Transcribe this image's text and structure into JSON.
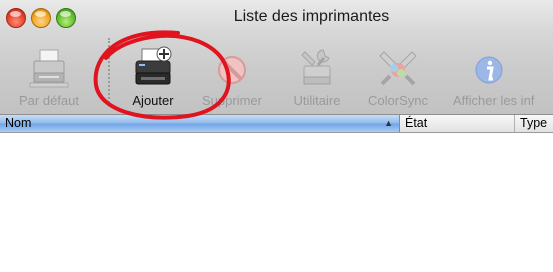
{
  "window": {
    "title": "Liste des imprimantes"
  },
  "toolbar": {
    "items": [
      {
        "id": "default",
        "label": "Par défaut",
        "icon": "printer-default-icon",
        "enabled": false
      },
      {
        "id": "add",
        "label": "Ajouter",
        "icon": "printer-add-icon",
        "enabled": true
      },
      {
        "id": "delete",
        "label": "Supprimer",
        "icon": "delete-icon",
        "enabled": false
      },
      {
        "id": "utility",
        "label": "Utilitaire",
        "icon": "tools-icon",
        "enabled": false
      },
      {
        "id": "colorsync",
        "label": "ColorSync",
        "icon": "colorsync-icon",
        "enabled": false
      },
      {
        "id": "info",
        "label": "Afficher les inf",
        "icon": "info-icon",
        "enabled": false
      }
    ]
  },
  "table": {
    "columns": [
      {
        "label": "Nom",
        "sorted": true,
        "sort_arrow": "▲"
      },
      {
        "label": "État"
      },
      {
        "label": "Type"
      }
    ],
    "rows": []
  },
  "colors": {
    "annotation": "#e0141e",
    "header_selected": "#8fb9ec",
    "accent_info": "#3d74d6"
  }
}
